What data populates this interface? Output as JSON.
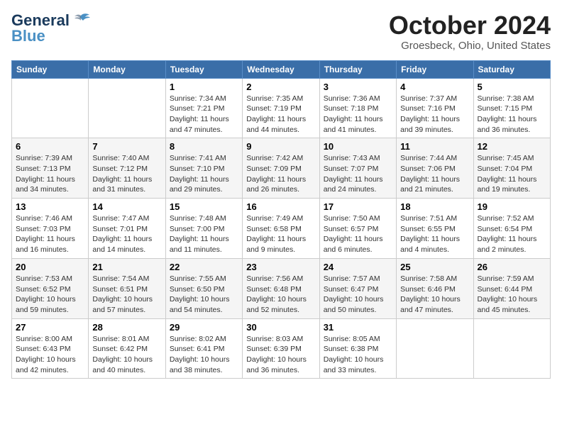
{
  "header": {
    "logo_line1": "General",
    "logo_line2": "Blue",
    "month": "October 2024",
    "location": "Groesbeck, Ohio, United States"
  },
  "days_of_week": [
    "Sunday",
    "Monday",
    "Tuesday",
    "Wednesday",
    "Thursday",
    "Friday",
    "Saturday"
  ],
  "weeks": [
    [
      {
        "num": "",
        "info": ""
      },
      {
        "num": "",
        "info": ""
      },
      {
        "num": "1",
        "info": "Sunrise: 7:34 AM\nSunset: 7:21 PM\nDaylight: 11 hours and 47 minutes."
      },
      {
        "num": "2",
        "info": "Sunrise: 7:35 AM\nSunset: 7:19 PM\nDaylight: 11 hours and 44 minutes."
      },
      {
        "num": "3",
        "info": "Sunrise: 7:36 AM\nSunset: 7:18 PM\nDaylight: 11 hours and 41 minutes."
      },
      {
        "num": "4",
        "info": "Sunrise: 7:37 AM\nSunset: 7:16 PM\nDaylight: 11 hours and 39 minutes."
      },
      {
        "num": "5",
        "info": "Sunrise: 7:38 AM\nSunset: 7:15 PM\nDaylight: 11 hours and 36 minutes."
      }
    ],
    [
      {
        "num": "6",
        "info": "Sunrise: 7:39 AM\nSunset: 7:13 PM\nDaylight: 11 hours and 34 minutes."
      },
      {
        "num": "7",
        "info": "Sunrise: 7:40 AM\nSunset: 7:12 PM\nDaylight: 11 hours and 31 minutes."
      },
      {
        "num": "8",
        "info": "Sunrise: 7:41 AM\nSunset: 7:10 PM\nDaylight: 11 hours and 29 minutes."
      },
      {
        "num": "9",
        "info": "Sunrise: 7:42 AM\nSunset: 7:09 PM\nDaylight: 11 hours and 26 minutes."
      },
      {
        "num": "10",
        "info": "Sunrise: 7:43 AM\nSunset: 7:07 PM\nDaylight: 11 hours and 24 minutes."
      },
      {
        "num": "11",
        "info": "Sunrise: 7:44 AM\nSunset: 7:06 PM\nDaylight: 11 hours and 21 minutes."
      },
      {
        "num": "12",
        "info": "Sunrise: 7:45 AM\nSunset: 7:04 PM\nDaylight: 11 hours and 19 minutes."
      }
    ],
    [
      {
        "num": "13",
        "info": "Sunrise: 7:46 AM\nSunset: 7:03 PM\nDaylight: 11 hours and 16 minutes."
      },
      {
        "num": "14",
        "info": "Sunrise: 7:47 AM\nSunset: 7:01 PM\nDaylight: 11 hours and 14 minutes."
      },
      {
        "num": "15",
        "info": "Sunrise: 7:48 AM\nSunset: 7:00 PM\nDaylight: 11 hours and 11 minutes."
      },
      {
        "num": "16",
        "info": "Sunrise: 7:49 AM\nSunset: 6:58 PM\nDaylight: 11 hours and 9 minutes."
      },
      {
        "num": "17",
        "info": "Sunrise: 7:50 AM\nSunset: 6:57 PM\nDaylight: 11 hours and 6 minutes."
      },
      {
        "num": "18",
        "info": "Sunrise: 7:51 AM\nSunset: 6:55 PM\nDaylight: 11 hours and 4 minutes."
      },
      {
        "num": "19",
        "info": "Sunrise: 7:52 AM\nSunset: 6:54 PM\nDaylight: 11 hours and 2 minutes."
      }
    ],
    [
      {
        "num": "20",
        "info": "Sunrise: 7:53 AM\nSunset: 6:52 PM\nDaylight: 10 hours and 59 minutes."
      },
      {
        "num": "21",
        "info": "Sunrise: 7:54 AM\nSunset: 6:51 PM\nDaylight: 10 hours and 57 minutes."
      },
      {
        "num": "22",
        "info": "Sunrise: 7:55 AM\nSunset: 6:50 PM\nDaylight: 10 hours and 54 minutes."
      },
      {
        "num": "23",
        "info": "Sunrise: 7:56 AM\nSunset: 6:48 PM\nDaylight: 10 hours and 52 minutes."
      },
      {
        "num": "24",
        "info": "Sunrise: 7:57 AM\nSunset: 6:47 PM\nDaylight: 10 hours and 50 minutes."
      },
      {
        "num": "25",
        "info": "Sunrise: 7:58 AM\nSunset: 6:46 PM\nDaylight: 10 hours and 47 minutes."
      },
      {
        "num": "26",
        "info": "Sunrise: 7:59 AM\nSunset: 6:44 PM\nDaylight: 10 hours and 45 minutes."
      }
    ],
    [
      {
        "num": "27",
        "info": "Sunrise: 8:00 AM\nSunset: 6:43 PM\nDaylight: 10 hours and 42 minutes."
      },
      {
        "num": "28",
        "info": "Sunrise: 8:01 AM\nSunset: 6:42 PM\nDaylight: 10 hours and 40 minutes."
      },
      {
        "num": "29",
        "info": "Sunrise: 8:02 AM\nSunset: 6:41 PM\nDaylight: 10 hours and 38 minutes."
      },
      {
        "num": "30",
        "info": "Sunrise: 8:03 AM\nSunset: 6:39 PM\nDaylight: 10 hours and 36 minutes."
      },
      {
        "num": "31",
        "info": "Sunrise: 8:05 AM\nSunset: 6:38 PM\nDaylight: 10 hours and 33 minutes."
      },
      {
        "num": "",
        "info": ""
      },
      {
        "num": "",
        "info": ""
      }
    ]
  ]
}
